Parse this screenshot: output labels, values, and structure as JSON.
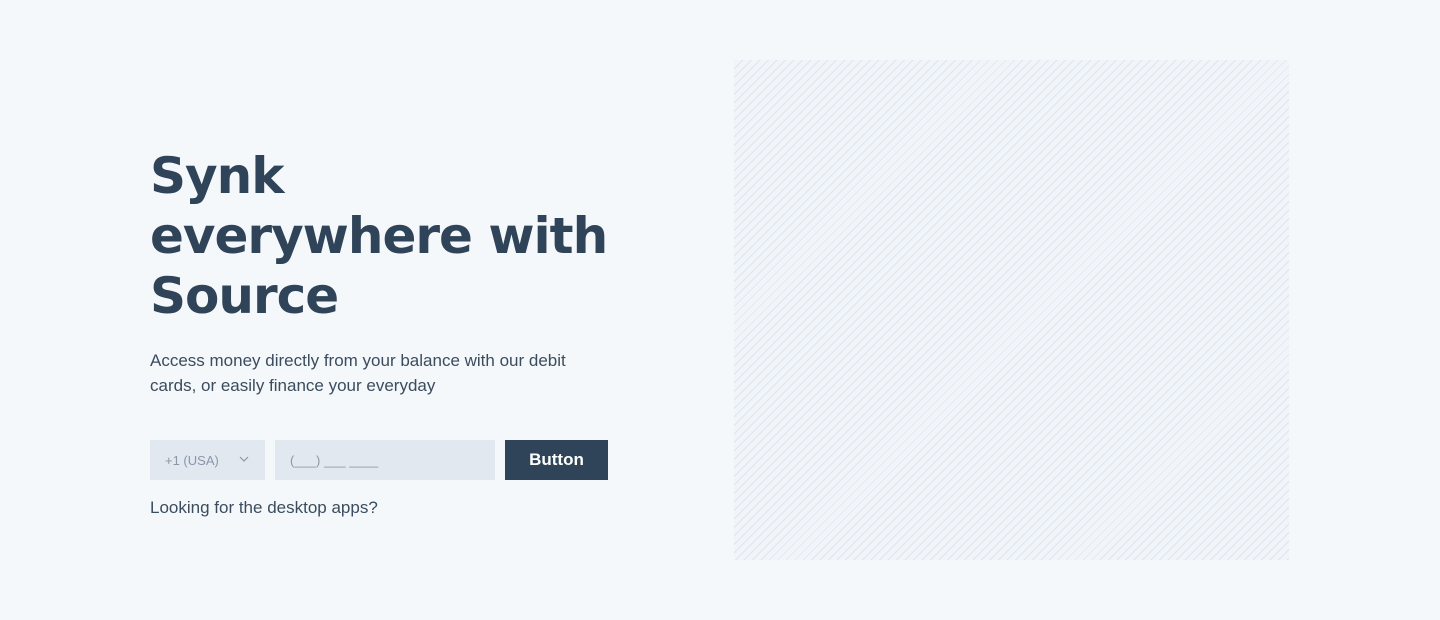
{
  "hero": {
    "title": "Synk everywhere with Source",
    "subtitle": "Access money directly from your balance with our debit cards, or easily finance your everyday"
  },
  "form": {
    "country_code": "+1 (USA)",
    "country_chevron_icon": "chevron-down-icon",
    "phone_placeholder": "(___) ___ ____",
    "phone_value": "",
    "button_label": "Button"
  },
  "desktop_link": {
    "label": "Looking for the desktop apps?"
  },
  "colors": {
    "background": "#f5f8fb",
    "primary": "#2f4458",
    "input_background": "#e2e8f0",
    "placeholder_text": "#8a97a8"
  }
}
